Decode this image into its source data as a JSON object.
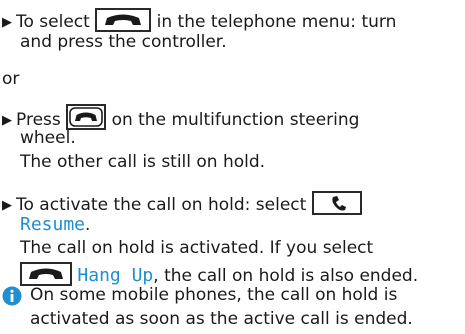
{
  "step1": {
    "pre": "To select",
    "post": "in the telephone menu: turn",
    "cont": "and press the controller."
  },
  "or_text": "or",
  "step2": {
    "pre": "Press",
    "post": "on the multifunction steering",
    "cont": "wheel.",
    "result": "The other call is still on hold."
  },
  "step3": {
    "pre": "To activate the call on hold: select",
    "resume": "Resume",
    "period": ".",
    "result1": "The call on hold is activated. If you select",
    "hangup": "Hang Up",
    "result2": ", the call on hold is also ended."
  },
  "note": {
    "line1": "On some mobile phones, the call on hold is",
    "line2": "activated as soon as the active call is ended."
  },
  "icons": {
    "end_call": "end-call-icon",
    "end_call_steering": "end-call-steering-icon",
    "phone": "phone-icon",
    "info": "info-icon"
  },
  "colors": {
    "text": "#1a1a1a",
    "accent": "#1f8fd0"
  }
}
